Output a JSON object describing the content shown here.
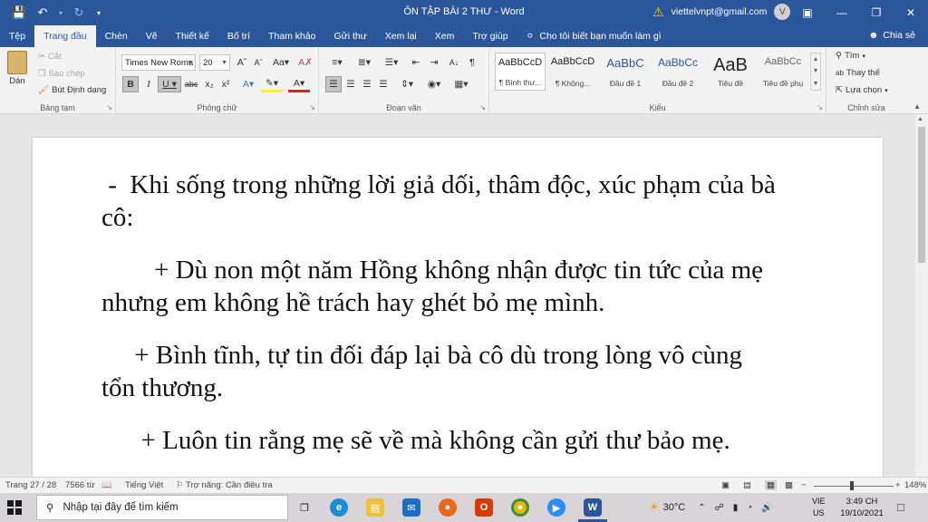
{
  "titlebar": {
    "title": "ÔN TẬP BÀI 2 THƯ  -  Word",
    "account_email": "viettelvnpt@gmail.com",
    "avatar_letter": "V"
  },
  "tabs": [
    "Tệp",
    "Trang đầu",
    "Chèn",
    "Vẽ",
    "Thiết kế",
    "Bố trí",
    "Tham khảo",
    "Gửi thư",
    "Xem lại",
    "Xem",
    "Trợ giúp"
  ],
  "active_tab": "Trang đầu",
  "tell_me": "Cho tôi biết bạn muốn làm gì",
  "share": "Chia sẻ",
  "ribbon": {
    "clipboard": {
      "label": "Bảng tạm",
      "paste": "Dán",
      "cut": "Cắt",
      "copy": "Sao chép",
      "format_painter": "Bút Định dạng"
    },
    "font": {
      "label": "Phông chữ",
      "font_name": "Times New Roma",
      "font_size": "20"
    },
    "paragraph": {
      "label": "Đoạn văn"
    },
    "styles": {
      "label": "Kiểu",
      "items": [
        {
          "preview": "AaBbCcD",
          "name": "¶ Bình thư..."
        },
        {
          "preview": "AaBbCcD",
          "name": "¶ Không..."
        },
        {
          "preview": "AaBbC",
          "name": "Đầu đề 1"
        },
        {
          "preview": "AaBbCc",
          "name": "Đầu đề 2"
        },
        {
          "preview": "AaB",
          "name": "Tiêu đề"
        },
        {
          "preview": "AaBbCc",
          "name": "Tiêu đề phụ"
        }
      ]
    },
    "editing": {
      "label": "Chỉnh sửa",
      "find": "Tìm",
      "replace": "Thay thế",
      "select": "Lựa chọn"
    }
  },
  "document": {
    "paragraphs": [
      [
        " -  Khi sống trong những lời giả dối, thâm độc, xúc phạm của bà",
        "cô:"
      ],
      [
        "        + Dù non một năm Hồng không nhận được tin tức của mẹ",
        "nhưng em không hề trách hay ghét bỏ mẹ mình."
      ],
      [
        "     + Bình tĩnh, tự tin đối đáp lại bà cô dù trong lòng vô cùng",
        "tổn thương."
      ],
      [
        "      + Luôn tin rằng mẹ sẽ về mà không cần gửi thư bảo mẹ."
      ]
    ]
  },
  "statusbar": {
    "page": "Trang 27 / 28",
    "words": "7566 từ",
    "language": "Tiếng Việt",
    "accessibility": "Trợ năng: Cần điều tra",
    "zoom": "148%"
  },
  "taskbar": {
    "search_placeholder": "Nhập tại đây để tìm kiếm",
    "temperature": "30°C",
    "lang_top": "VIE",
    "lang_bottom": "US",
    "time": "3:49 CH",
    "date": "19/10/2021"
  }
}
